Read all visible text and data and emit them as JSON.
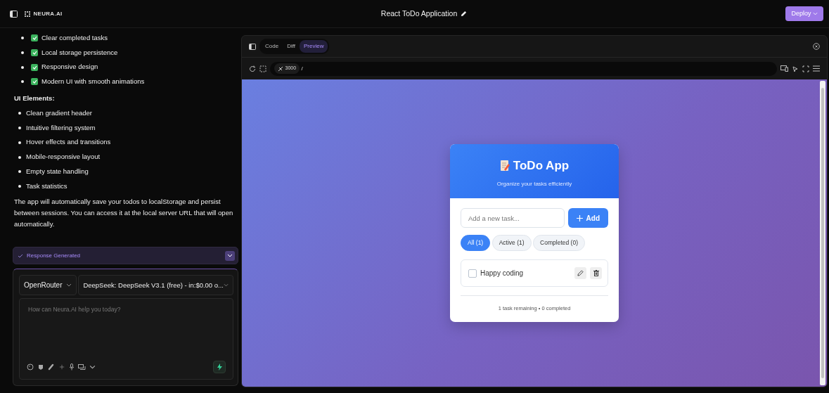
{
  "header": {
    "logo": "NEURA.AI",
    "title": "React ToDo Application",
    "deploy": "Deploy"
  },
  "chat": {
    "feature_items": [
      {
        "text": "Clear completed tasks",
        "checked": true
      },
      {
        "text": "Local storage persistence",
        "checked": true
      },
      {
        "text": "Responsive design",
        "checked": true
      },
      {
        "text": "Modern UI with smooth animations",
        "checked": true
      }
    ],
    "section_heading": "UI Elements:",
    "ui_items": [
      "Clean gradient header",
      "Intuitive filtering system",
      "Hover effects and transitions",
      "Mobile-responsive layout",
      "Empty state handling",
      "Task statistics"
    ],
    "paragraph": "The app will automatically save your todos to localStorage and persist between sessions. You can access it at the local server URL that will open automatically.",
    "status": "Response Generated",
    "provider": "OpenRouter",
    "model": "DeepSeek: DeepSeek V3.1 (free) - in:$0.00 o...",
    "prompt_placeholder": "How can Neura.AI help you today?"
  },
  "workbench": {
    "tabs": [
      {
        "label": "Code",
        "selected": false
      },
      {
        "label": "Diff",
        "selected": false
      },
      {
        "label": "Preview",
        "selected": true
      }
    ],
    "port": "3000",
    "path": "/",
    "app": {
      "title": "ToDo App",
      "subtitle": "Organize your tasks efficiently",
      "input_placeholder": "Add a new task...",
      "add_label": "Add",
      "filters": [
        {
          "label": "All (1)",
          "selected": true
        },
        {
          "label": "Active (1)",
          "selected": false
        },
        {
          "label": "Completed (0)",
          "selected": false
        }
      ],
      "todos": [
        {
          "text": "Happy coding",
          "checked": false
        }
      ],
      "footer": "1 task remaining • 0 completed"
    }
  }
}
